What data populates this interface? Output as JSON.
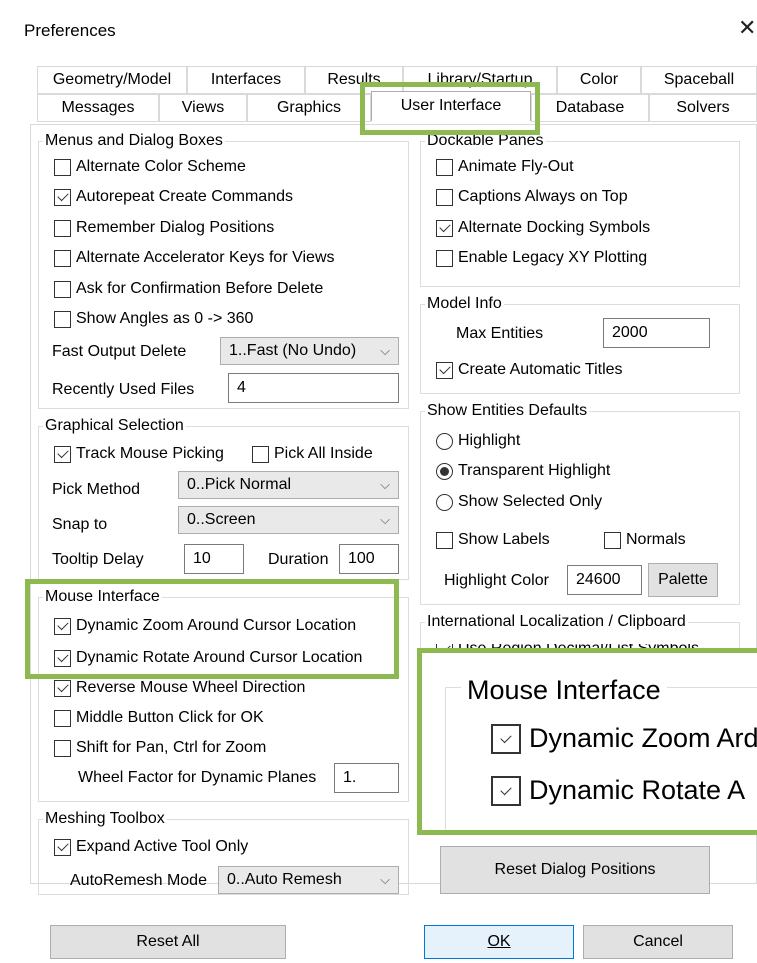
{
  "window": {
    "title": "Preferences",
    "close_glyph": "✕"
  },
  "tabs": {
    "row1": [
      "Geometry/Model",
      "Interfaces",
      "Results",
      "Library/Startup",
      "Color",
      "Spaceball"
    ],
    "row2": [
      "Messages",
      "Views",
      "Graphics",
      "User Interface",
      "Database",
      "Solvers"
    ],
    "selected": "User Interface"
  },
  "menus_dialog": {
    "title": "Menus and Dialog Boxes",
    "options": [
      {
        "label": "Alternate Color Scheme",
        "checked": false
      },
      {
        "label": "Autorepeat Create Commands",
        "checked": true
      },
      {
        "label": "Remember Dialog Positions",
        "checked": false
      },
      {
        "label": "Alternate Accelerator Keys for Views",
        "checked": false
      },
      {
        "label": "Ask for Confirmation Before Delete",
        "checked": false
      },
      {
        "label": "Show Angles as 0 -> 360",
        "checked": false
      }
    ],
    "fast_output_label": "Fast Output Delete",
    "fast_output_value": "1..Fast (No Undo)",
    "recent_files_label": "Recently Used Files",
    "recent_files_value": "4"
  },
  "graphical_selection": {
    "title": "Graphical Selection",
    "track_mouse": {
      "label": "Track Mouse Picking",
      "checked": true
    },
    "pick_all_inside": {
      "label": "Pick All Inside",
      "checked": false
    },
    "pick_method_label": "Pick Method",
    "pick_method_value": "0..Pick Normal",
    "snap_label": "Snap to",
    "snap_value": "0..Screen",
    "tooltip_label": "Tooltip Delay",
    "tooltip_value": "10",
    "duration_label": "Duration",
    "duration_value": "100"
  },
  "mouse_interface": {
    "title": "Mouse Interface",
    "options": [
      {
        "label": "Dynamic Zoom Around Cursor Location",
        "checked": true
      },
      {
        "label": "Dynamic Rotate Around Cursor Location",
        "checked": true
      },
      {
        "label": "Reverse Mouse Wheel Direction",
        "checked": true
      },
      {
        "label": "Middle Button Click for OK",
        "checked": false
      },
      {
        "label": "Shift for Pan, Ctrl for Zoom",
        "checked": false
      }
    ],
    "wheel_factor_label": "Wheel Factor for Dynamic Planes",
    "wheel_factor_value": "1."
  },
  "meshing_toolbox": {
    "title": "Meshing Toolbox",
    "expand": {
      "label": "Expand Active Tool Only",
      "checked": true
    },
    "autoremesh_label": "AutoRemesh Mode",
    "autoremesh_value": "0..Auto Remesh"
  },
  "dockable_panes": {
    "title": "Dockable Panes",
    "options": [
      {
        "label": "Animate Fly-Out",
        "checked": false
      },
      {
        "label": "Captions Always on Top",
        "checked": false
      },
      {
        "label": "Alternate Docking Symbols",
        "checked": true
      },
      {
        "label": "Enable Legacy XY Plotting",
        "checked": false
      }
    ]
  },
  "model_info": {
    "title": "Model Info",
    "max_entities_label": "Max Entities",
    "max_entities_value": "2000",
    "auto_titles": {
      "label": "Create Automatic Titles",
      "checked": true
    }
  },
  "show_entities": {
    "title": "Show Entities Defaults",
    "radios": [
      {
        "label": "Highlight",
        "checked": false
      },
      {
        "label": "Transparent Highlight",
        "checked": true
      },
      {
        "label": "Show Selected Only",
        "checked": false
      }
    ],
    "show_labels": {
      "label": "Show Labels",
      "checked": false
    },
    "normals": {
      "label": "Normals",
      "checked": false
    },
    "highlight_color_label": "Highlight Color",
    "highlight_color_value": "24600",
    "palette_label": "Palette"
  },
  "international": {
    "title": "International Localization / Clipboard",
    "partial_label": "Use Region Decimal/List Symbols"
  },
  "zoom_callout": {
    "title": "Mouse Interface",
    "line1": "Dynamic Zoom Ard",
    "line2": "Dynamic Rotate A"
  },
  "buttons": {
    "reset_dialog_positions": "Reset Dialog Positions",
    "reset_all": "Reset All",
    "ok": "OK",
    "cancel": "Cancel"
  },
  "colors": {
    "highlight": "#8cba51",
    "focus": "#0078d7"
  }
}
